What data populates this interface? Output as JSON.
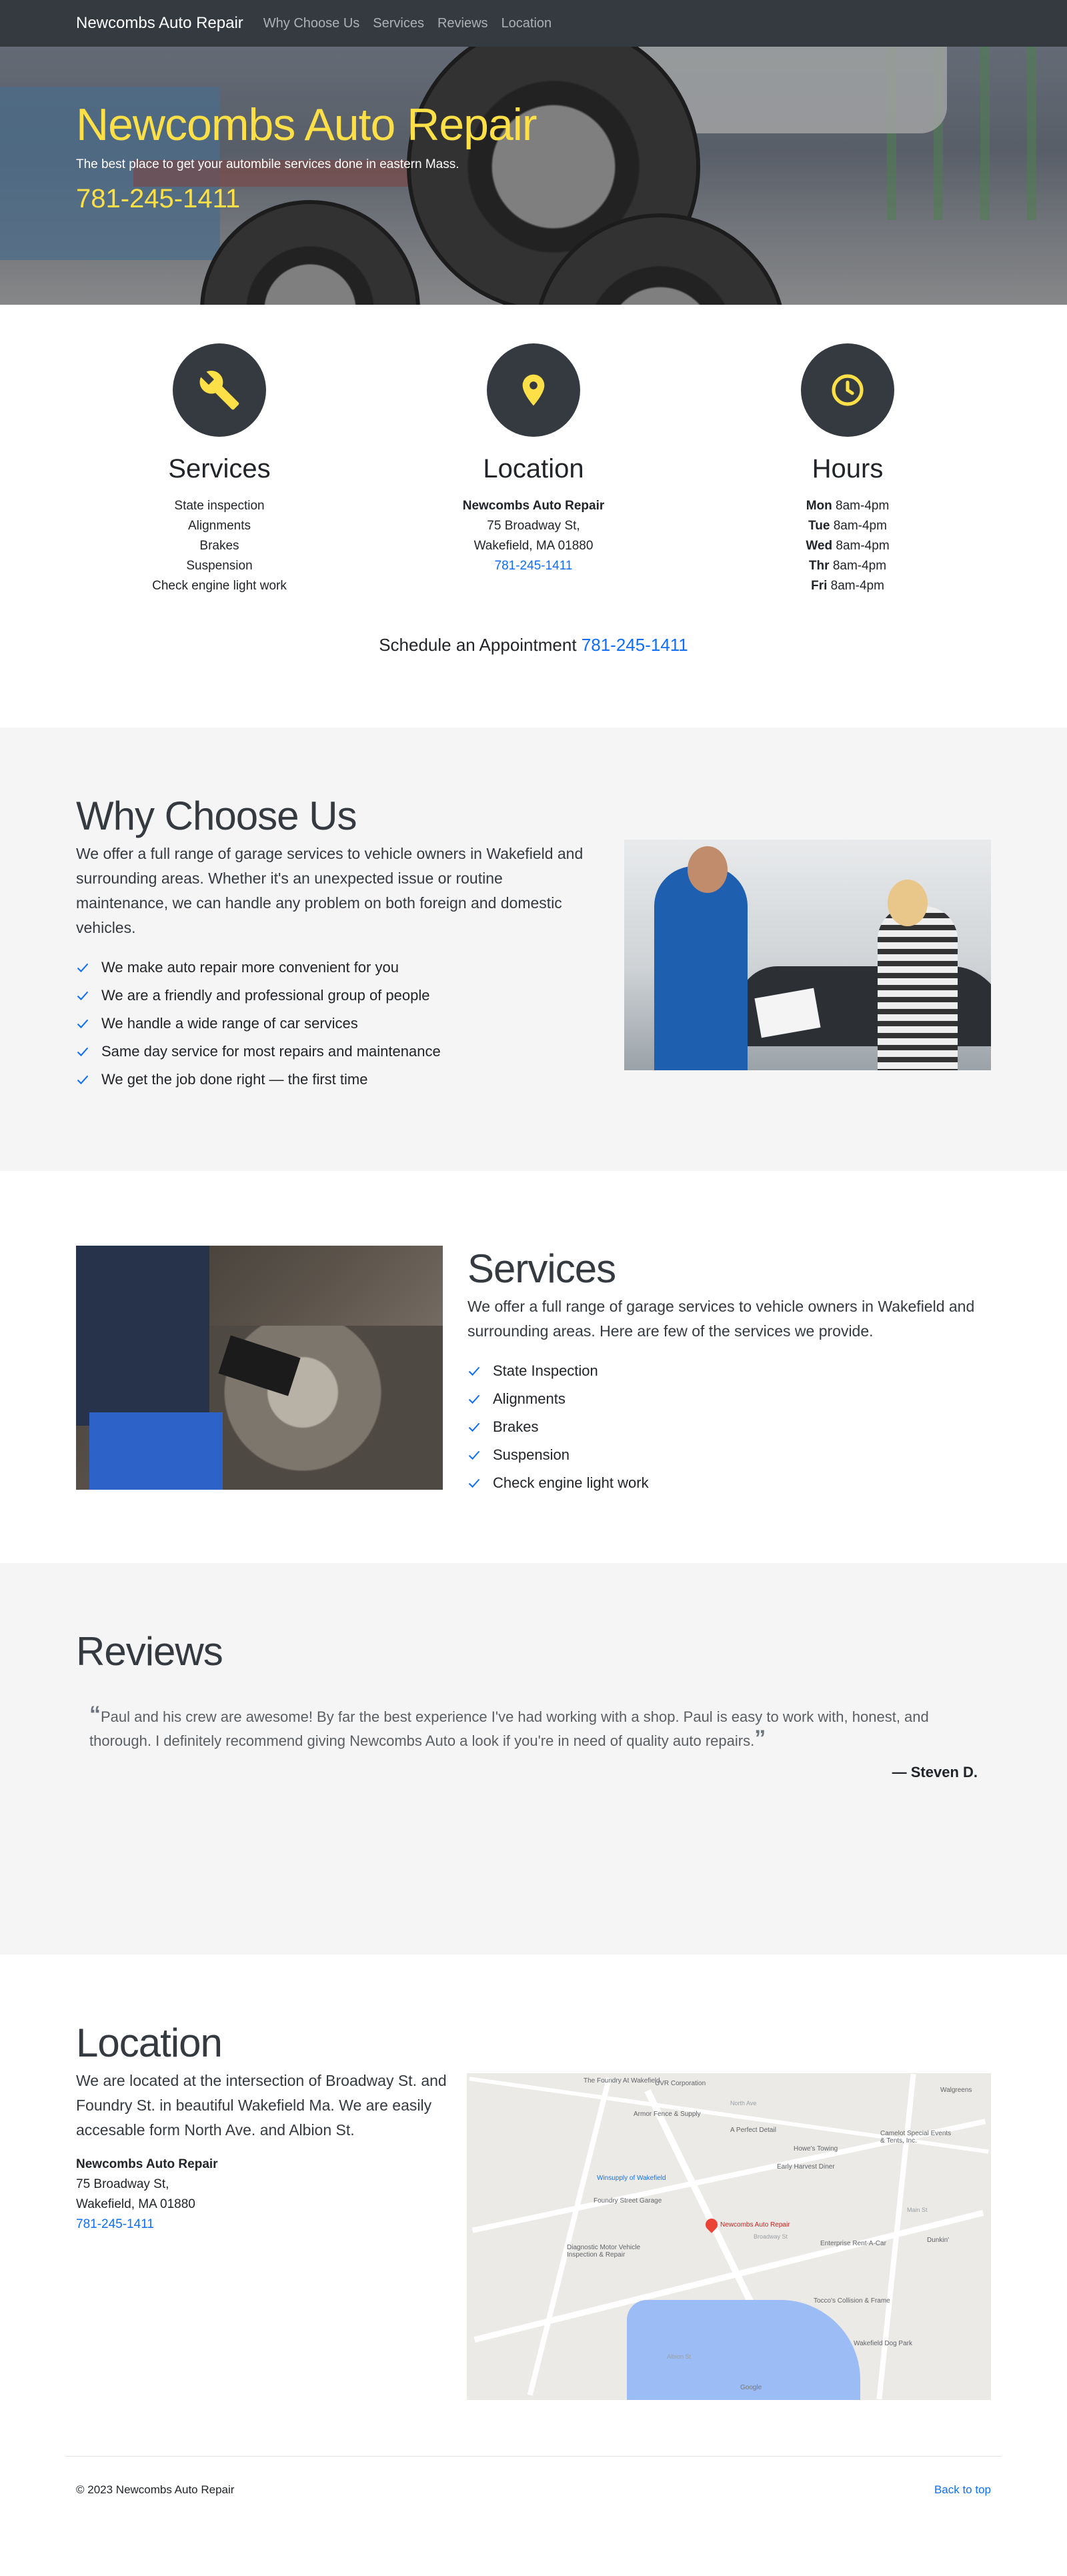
{
  "nav": {
    "brand": "Newcombs Auto Repair",
    "links": [
      "Why Choose Us",
      "Services",
      "Reviews",
      "Location"
    ]
  },
  "hero": {
    "title": "Newcombs Auto Repair",
    "subtitle": "The best place to get your autombile services done in eastern Mass.",
    "phone": "781-245-1411"
  },
  "features": {
    "services": {
      "icon": "wrench-icon",
      "title": "Services",
      "items": [
        "State inspection",
        "Alignments",
        "Brakes",
        "Suspension",
        "Check engine light work"
      ]
    },
    "location": {
      "icon": "map-pin-icon",
      "title": "Location",
      "name": "Newcombs Auto Repair",
      "street": "75 Broadway St,",
      "city": "Wakefield, MA 01880",
      "phone": "781-245-1411"
    },
    "hours": {
      "icon": "clock-icon",
      "title": "Hours",
      "rows": [
        {
          "day": "Mon",
          "time": "8am-4pm"
        },
        {
          "day": "Tue",
          "time": "8am-4pm"
        },
        {
          "day": "Wed",
          "time": "8am-4pm"
        },
        {
          "day": "Thr",
          "time": "8am-4pm"
        },
        {
          "day": "Fri",
          "time": "8am-4pm"
        }
      ]
    }
  },
  "schedule": {
    "label": "Schedule an Appointment",
    "phone": "781-245-1411"
  },
  "why": {
    "title": "Why Choose Us",
    "lead": "We offer a full range of garage services to vehicle owners in Wakefield and surrounding areas. Whether it's an unexpected issue or routine maintenance, we can handle any problem on both foreign and domestic vehicles.",
    "points": [
      "We make auto repair more convenient for you",
      "We are a friendly and professional group of people",
      "We handle a wide range of car services",
      "Same day service for most repairs and maintenance",
      "We get the job done right — the first time"
    ]
  },
  "services_section": {
    "title": "Services",
    "lead": "We offer a full range of garage services to vehicle owners in Wakefield and surrounding areas. Here are few of the services we provide.",
    "items": [
      "State Inspection",
      "Alignments",
      "Brakes",
      "Suspension",
      "Check engine light work"
    ]
  },
  "reviews": {
    "title": "Reviews",
    "quote": "Paul and his crew are awesome! By far the best experience I've had working with a shop. Paul is easy to work with, honest, and thorough. I definitely recommend giving Newcombs Auto a look if you're in need of quality auto repairs.",
    "author": "— Steven D."
  },
  "location_section": {
    "title": "Location",
    "lead": "We are located at the intersection of Broadway St. and Foundry St. in beautiful Wakefield Ma. We are easily accesable form North Ave. and Albion St.",
    "name": "Newcombs Auto Repair",
    "street": "75 Broadway St,",
    "city": "Wakefield, MA 01880",
    "phone": "781-245-1411"
  },
  "map": {
    "labels": {
      "pin": "Newcombs Auto Repair",
      "l1": "The Foundry At Wakefield",
      "l2": "UVR Corporation",
      "l3": "Armor Fence & Supply",
      "l4": "A Perfect Detail",
      "l5": "Howe's Towing",
      "l6": "Winsupply of Wakefield",
      "l7": "Early Harvest Diner",
      "l8": "Foundry Street Garage",
      "l9": "Enterprise Rent-A-Car",
      "l10": "Diagnostic Motor Vehicle Inspection & Repair",
      "l11": "Tocco's Collision & Frame",
      "l12": "Wakefield Dog Park",
      "l13": "Walgreens",
      "l14": "Camelot Special Events & Tents, Inc.",
      "l15": "Dunkin'",
      "r1": "North Ave",
      "r2": "Broadway St",
      "r3": "Albion St",
      "r4": "Main St",
      "brand": "Google"
    }
  },
  "footer": {
    "copyright": "© 2023 Newcombs Auto Repair",
    "back_to_top": "Back to top"
  },
  "colors": {
    "accent_yellow": "#fde047",
    "link_blue": "#0d6efd",
    "dark": "#343a40",
    "section_gray": "#f5f5f5"
  }
}
